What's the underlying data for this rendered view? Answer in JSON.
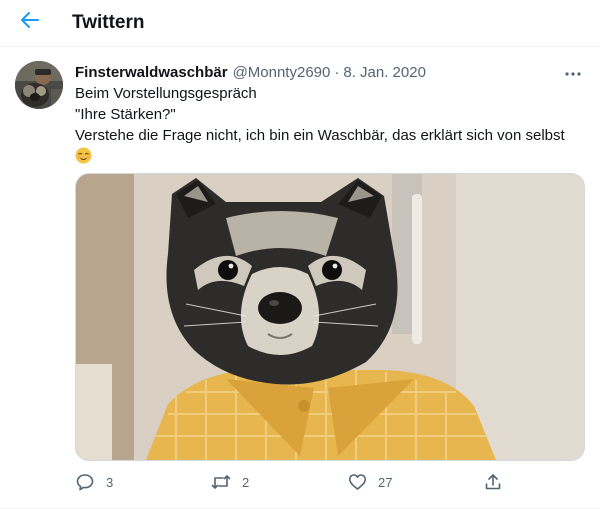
{
  "header": {
    "title": "Twittern"
  },
  "tweet": {
    "author_name": "Finsterwaldwaschbär",
    "author_handle": "@Monnty2690",
    "separator": "·",
    "date": "8. Jan. 2020",
    "lines": [
      "Beim Vorstellungsgespräch",
      "\"Ihre Stärken?\"",
      "Verstehe die Frage nicht, ich bin ein Waschbär, das erklärt sich von selbst"
    ],
    "emoji": "relieved-face-emoji",
    "media": "raccoon-in-checkered-shirt-photo"
  },
  "actions": {
    "reply_count": "3",
    "retweet_count": "2",
    "like_count": "27"
  },
  "colors": {
    "accent": "#1d9bf0",
    "text_primary": "#0f1419",
    "text_secondary": "#536471",
    "border": "#cfd9de"
  },
  "icons": [
    "back-arrow-icon",
    "more-icon",
    "reply-icon",
    "retweet-icon",
    "like-icon",
    "share-icon"
  ]
}
